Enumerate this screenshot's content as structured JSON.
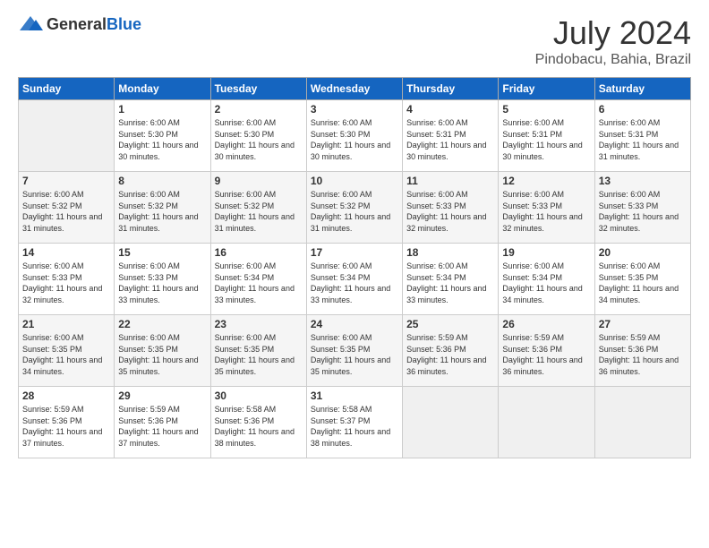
{
  "header": {
    "logo_general": "General",
    "logo_blue": "Blue",
    "month_title": "July 2024",
    "location": "Pindobacu, Bahia, Brazil"
  },
  "weekdays": [
    "Sunday",
    "Monday",
    "Tuesday",
    "Wednesday",
    "Thursday",
    "Friday",
    "Saturday"
  ],
  "weeks": [
    [
      {
        "day": "",
        "empty": true
      },
      {
        "day": "1",
        "sunrise": "Sunrise: 6:00 AM",
        "sunset": "Sunset: 5:30 PM",
        "daylight": "Daylight: 11 hours and 30 minutes."
      },
      {
        "day": "2",
        "sunrise": "Sunrise: 6:00 AM",
        "sunset": "Sunset: 5:30 PM",
        "daylight": "Daylight: 11 hours and 30 minutes."
      },
      {
        "day": "3",
        "sunrise": "Sunrise: 6:00 AM",
        "sunset": "Sunset: 5:30 PM",
        "daylight": "Daylight: 11 hours and 30 minutes."
      },
      {
        "day": "4",
        "sunrise": "Sunrise: 6:00 AM",
        "sunset": "Sunset: 5:31 PM",
        "daylight": "Daylight: 11 hours and 30 minutes."
      },
      {
        "day": "5",
        "sunrise": "Sunrise: 6:00 AM",
        "sunset": "Sunset: 5:31 PM",
        "daylight": "Daylight: 11 hours and 30 minutes."
      },
      {
        "day": "6",
        "sunrise": "Sunrise: 6:00 AM",
        "sunset": "Sunset: 5:31 PM",
        "daylight": "Daylight: 11 hours and 31 minutes."
      }
    ],
    [
      {
        "day": "7",
        "sunrise": "Sunrise: 6:00 AM",
        "sunset": "Sunset: 5:32 PM",
        "daylight": "Daylight: 11 hours and 31 minutes."
      },
      {
        "day": "8",
        "sunrise": "Sunrise: 6:00 AM",
        "sunset": "Sunset: 5:32 PM",
        "daylight": "Daylight: 11 hours and 31 minutes."
      },
      {
        "day": "9",
        "sunrise": "Sunrise: 6:00 AM",
        "sunset": "Sunset: 5:32 PM",
        "daylight": "Daylight: 11 hours and 31 minutes."
      },
      {
        "day": "10",
        "sunrise": "Sunrise: 6:00 AM",
        "sunset": "Sunset: 5:32 PM",
        "daylight": "Daylight: 11 hours and 31 minutes."
      },
      {
        "day": "11",
        "sunrise": "Sunrise: 6:00 AM",
        "sunset": "Sunset: 5:33 PM",
        "daylight": "Daylight: 11 hours and 32 minutes."
      },
      {
        "day": "12",
        "sunrise": "Sunrise: 6:00 AM",
        "sunset": "Sunset: 5:33 PM",
        "daylight": "Daylight: 11 hours and 32 minutes."
      },
      {
        "day": "13",
        "sunrise": "Sunrise: 6:00 AM",
        "sunset": "Sunset: 5:33 PM",
        "daylight": "Daylight: 11 hours and 32 minutes."
      }
    ],
    [
      {
        "day": "14",
        "sunrise": "Sunrise: 6:00 AM",
        "sunset": "Sunset: 5:33 PM",
        "daylight": "Daylight: 11 hours and 32 minutes."
      },
      {
        "day": "15",
        "sunrise": "Sunrise: 6:00 AM",
        "sunset": "Sunset: 5:33 PM",
        "daylight": "Daylight: 11 hours and 33 minutes."
      },
      {
        "day": "16",
        "sunrise": "Sunrise: 6:00 AM",
        "sunset": "Sunset: 5:34 PM",
        "daylight": "Daylight: 11 hours and 33 minutes."
      },
      {
        "day": "17",
        "sunrise": "Sunrise: 6:00 AM",
        "sunset": "Sunset: 5:34 PM",
        "daylight": "Daylight: 11 hours and 33 minutes."
      },
      {
        "day": "18",
        "sunrise": "Sunrise: 6:00 AM",
        "sunset": "Sunset: 5:34 PM",
        "daylight": "Daylight: 11 hours and 33 minutes."
      },
      {
        "day": "19",
        "sunrise": "Sunrise: 6:00 AM",
        "sunset": "Sunset: 5:34 PM",
        "daylight": "Daylight: 11 hours and 34 minutes."
      },
      {
        "day": "20",
        "sunrise": "Sunrise: 6:00 AM",
        "sunset": "Sunset: 5:35 PM",
        "daylight": "Daylight: 11 hours and 34 minutes."
      }
    ],
    [
      {
        "day": "21",
        "sunrise": "Sunrise: 6:00 AM",
        "sunset": "Sunset: 5:35 PM",
        "daylight": "Daylight: 11 hours and 34 minutes."
      },
      {
        "day": "22",
        "sunrise": "Sunrise: 6:00 AM",
        "sunset": "Sunset: 5:35 PM",
        "daylight": "Daylight: 11 hours and 35 minutes."
      },
      {
        "day": "23",
        "sunrise": "Sunrise: 6:00 AM",
        "sunset": "Sunset: 5:35 PM",
        "daylight": "Daylight: 11 hours and 35 minutes."
      },
      {
        "day": "24",
        "sunrise": "Sunrise: 6:00 AM",
        "sunset": "Sunset: 5:35 PM",
        "daylight": "Daylight: 11 hours and 35 minutes."
      },
      {
        "day": "25",
        "sunrise": "Sunrise: 5:59 AM",
        "sunset": "Sunset: 5:36 PM",
        "daylight": "Daylight: 11 hours and 36 minutes."
      },
      {
        "day": "26",
        "sunrise": "Sunrise: 5:59 AM",
        "sunset": "Sunset: 5:36 PM",
        "daylight": "Daylight: 11 hours and 36 minutes."
      },
      {
        "day": "27",
        "sunrise": "Sunrise: 5:59 AM",
        "sunset": "Sunset: 5:36 PM",
        "daylight": "Daylight: 11 hours and 36 minutes."
      }
    ],
    [
      {
        "day": "28",
        "sunrise": "Sunrise: 5:59 AM",
        "sunset": "Sunset: 5:36 PM",
        "daylight": "Daylight: 11 hours and 37 minutes."
      },
      {
        "day": "29",
        "sunrise": "Sunrise: 5:59 AM",
        "sunset": "Sunset: 5:36 PM",
        "daylight": "Daylight: 11 hours and 37 minutes."
      },
      {
        "day": "30",
        "sunrise": "Sunrise: 5:58 AM",
        "sunset": "Sunset: 5:36 PM",
        "daylight": "Daylight: 11 hours and 38 minutes."
      },
      {
        "day": "31",
        "sunrise": "Sunrise: 5:58 AM",
        "sunset": "Sunset: 5:37 PM",
        "daylight": "Daylight: 11 hours and 38 minutes."
      },
      {
        "day": "",
        "empty": true
      },
      {
        "day": "",
        "empty": true
      },
      {
        "day": "",
        "empty": true
      }
    ]
  ]
}
